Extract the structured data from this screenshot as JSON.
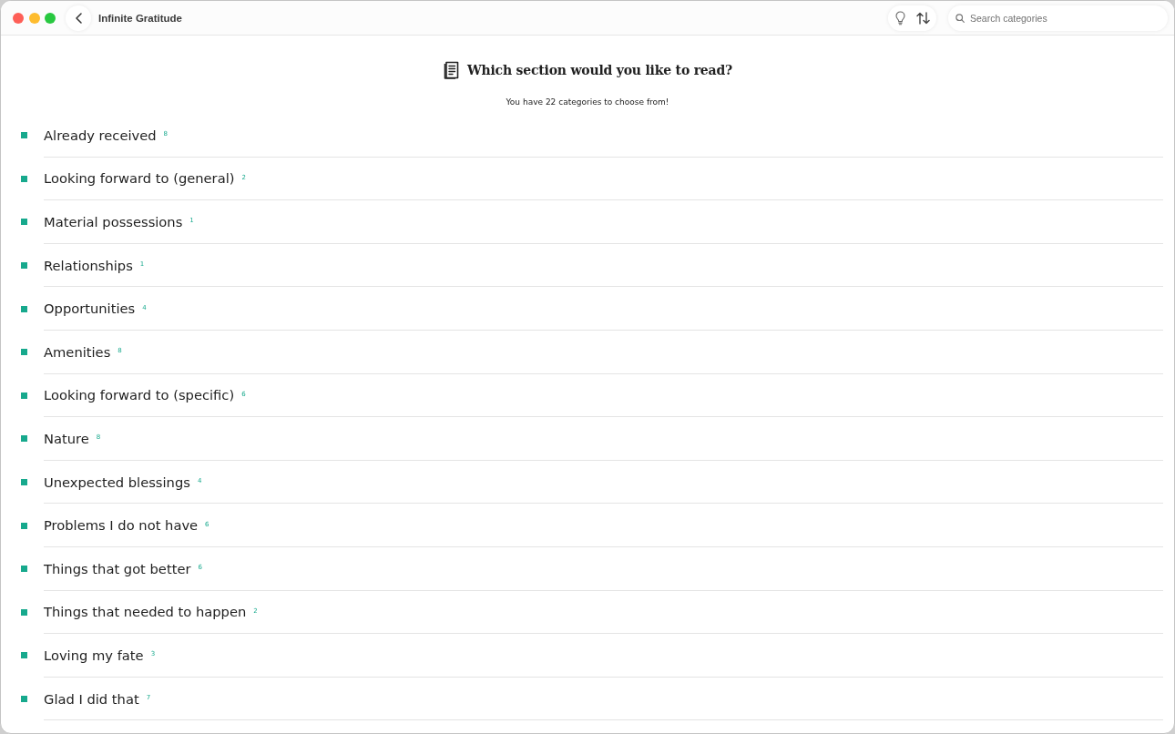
{
  "window": {
    "title": "Infinite Gratitude"
  },
  "toolbar": {
    "search": {
      "placeholder": "Search categories"
    }
  },
  "header": {
    "heading": "Which section would you like to read?",
    "subtitle": "You have 22 categories to choose from!"
  },
  "categories": [
    {
      "name": "Already received",
      "count": "8"
    },
    {
      "name": "Looking forward to (general)",
      "count": "2"
    },
    {
      "name": "Material possessions",
      "count": "1"
    },
    {
      "name": "Relationships",
      "count": "1"
    },
    {
      "name": "Opportunities",
      "count": "4"
    },
    {
      "name": "Amenities",
      "count": "8"
    },
    {
      "name": "Looking forward to (specific)",
      "count": "6"
    },
    {
      "name": "Nature",
      "count": "8"
    },
    {
      "name": "Unexpected blessings",
      "count": "4"
    },
    {
      "name": "Problems I do not have",
      "count": "6"
    },
    {
      "name": "Things that got better",
      "count": "6"
    },
    {
      "name": "Things that needed to happen",
      "count": "2"
    },
    {
      "name": "Loving my fate",
      "count": "3"
    },
    {
      "name": "Glad I did that",
      "count": "7"
    }
  ]
}
